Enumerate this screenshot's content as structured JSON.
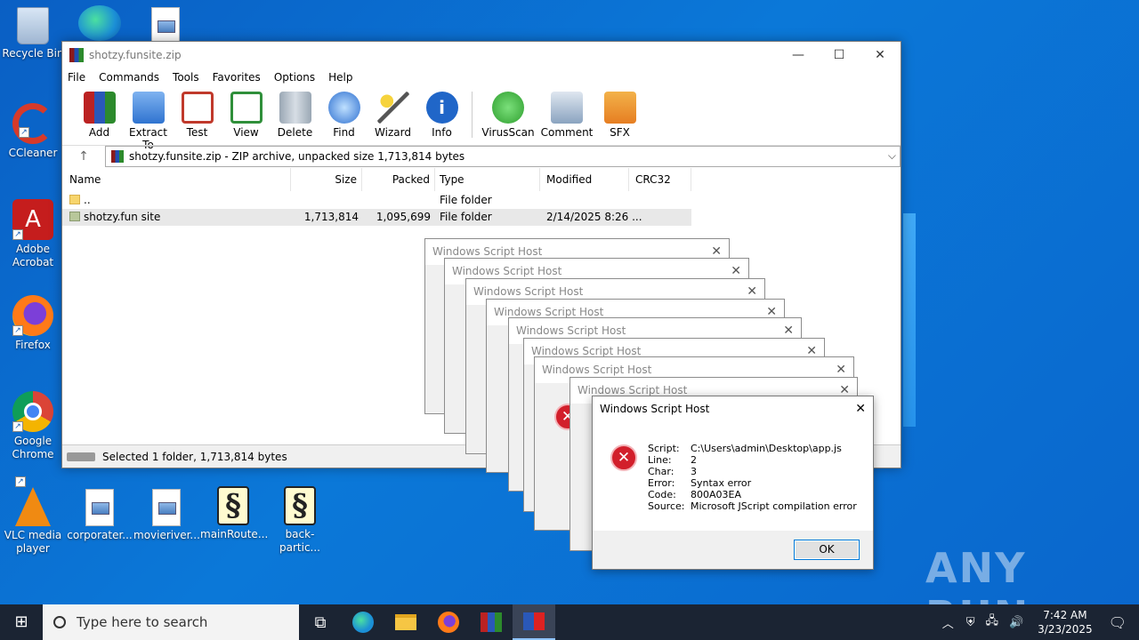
{
  "desktop": {
    "icons": [
      {
        "label": "Recycle Bin",
        "icon": "recycle-bin-icon"
      },
      {
        "label": "CCleaner",
        "icon": "ccleaner-icon"
      },
      {
        "label": "Adobe\nAcrobat",
        "icon": "adobe-acrobat-icon"
      },
      {
        "label": "Firefox",
        "icon": "firefox-icon"
      },
      {
        "label": "Google\nChrome",
        "icon": "chrome-icon"
      },
      {
        "label": "VLC media\nplayer",
        "icon": "vlc-icon"
      }
    ],
    "files": [
      {
        "label": "corporater...",
        "icon": "image-file-icon"
      },
      {
        "label": "movieriver...",
        "icon": "image-file-icon"
      },
      {
        "label": "mainRoute...",
        "icon": "script-file-icon"
      },
      {
        "label": "back-partic...",
        "icon": "script-file-icon"
      }
    ]
  },
  "winrar": {
    "title": "shotzy.funsite.zip",
    "menu": [
      "File",
      "Commands",
      "Tools",
      "Favorites",
      "Options",
      "Help"
    ],
    "toolbar": [
      {
        "label": "Add",
        "color": "#c0392b"
      },
      {
        "label": "Extract To",
        "color": "#3d7fd6"
      },
      {
        "label": "Test",
        "color": "#d9413a"
      },
      {
        "label": "View",
        "color": "#2f8f3a"
      },
      {
        "label": "Delete",
        "color": "#7f8c9a"
      },
      {
        "label": "Find",
        "color": "#2d6fd0"
      },
      {
        "label": "Wizard",
        "color": "#9b59b6"
      },
      {
        "label": "Info",
        "color": "#2066c8"
      },
      {
        "label": "VirusScan",
        "color": "#2e9e2e"
      },
      {
        "label": "Comment",
        "color": "#6a8fb8"
      },
      {
        "label": "SFX",
        "color": "#e67e22"
      }
    ],
    "path": "shotzy.funsite.zip - ZIP archive, unpacked size 1,713,814 bytes",
    "columns": [
      "Name",
      "Size",
      "Packed",
      "Type",
      "Modified",
      "CRC32"
    ],
    "rows": [
      {
        "name": "..",
        "size": "",
        "packed": "",
        "type": "File folder",
        "modified": ""
      },
      {
        "name": "shotzy.fun site",
        "size": "1,713,814",
        "packed": "1,095,699",
        "type": "File folder",
        "modified": "2/14/2025 8:26 ..."
      }
    ],
    "status": "Selected 1 folder, 1,713,814 bytes"
  },
  "dialog": {
    "title": "Windows Script Host",
    "fields": [
      {
        "k": "Script:",
        "v": "C:\\Users\\admin\\Desktop\\app.js"
      },
      {
        "k": "Line:",
        "v": "2"
      },
      {
        "k": "Char:",
        "v": "3"
      },
      {
        "k": "Error:",
        "v": "Syntax error"
      },
      {
        "k": "Code:",
        "v": "800A03EA"
      },
      {
        "k": "Source:",
        "v": "Microsoft JScript compilation error"
      }
    ],
    "ok_label": "OK"
  },
  "taskbar": {
    "search_placeholder": "Type here to search",
    "time": "7:42 AM",
    "date": "3/23/2025"
  },
  "watermark": "ANY RUN"
}
